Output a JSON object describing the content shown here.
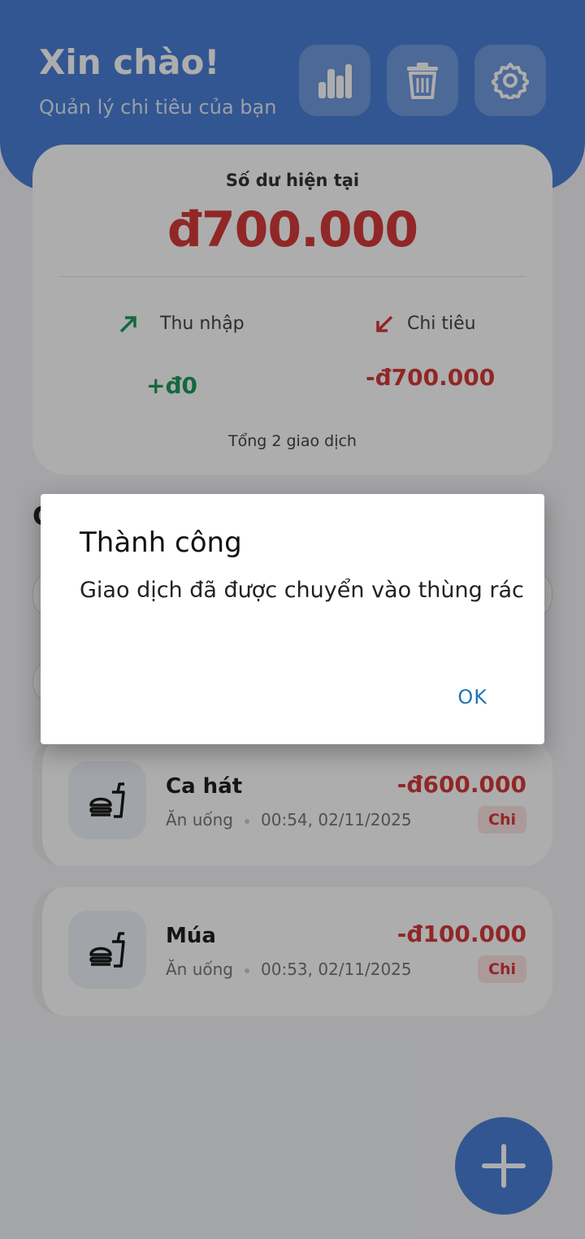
{
  "header": {
    "greeting": "Xin chào!",
    "subtitle": "Quản lý chi tiêu của bạn",
    "icons": [
      "chart-icon",
      "trash-icon",
      "gear-icon"
    ]
  },
  "summary": {
    "balance_label": "Số dư hiện tại",
    "balance_value": "đ700.000",
    "income_label": "Thu nhập",
    "income_value": "+đ0",
    "expense_label": "Chi tiêu",
    "expense_value": "-đ700.000",
    "total_text": "Tổng 2 giao dịch"
  },
  "section": {
    "title_initial": "G"
  },
  "transactions": [
    {
      "name": "Ca hát",
      "category": "Ăn uống",
      "time": "00:54, 02/11/2025",
      "amount": "-đ600.000",
      "badge": "Chi",
      "icon": "fastfood-icon"
    },
    {
      "name": "Múa",
      "category": "Ăn uống",
      "time": "00:53, 02/11/2025",
      "amount": "-đ100.000",
      "badge": "Chi",
      "icon": "fastfood-icon"
    }
  ],
  "dialog": {
    "title": "Thành công",
    "message": "Giao dịch đã được chuyển vào thùng rác",
    "ok_label": "OK"
  },
  "colors": {
    "primary": "#4a7fd6",
    "expense": "#d63a3a",
    "income": "#1e9a5b"
  }
}
